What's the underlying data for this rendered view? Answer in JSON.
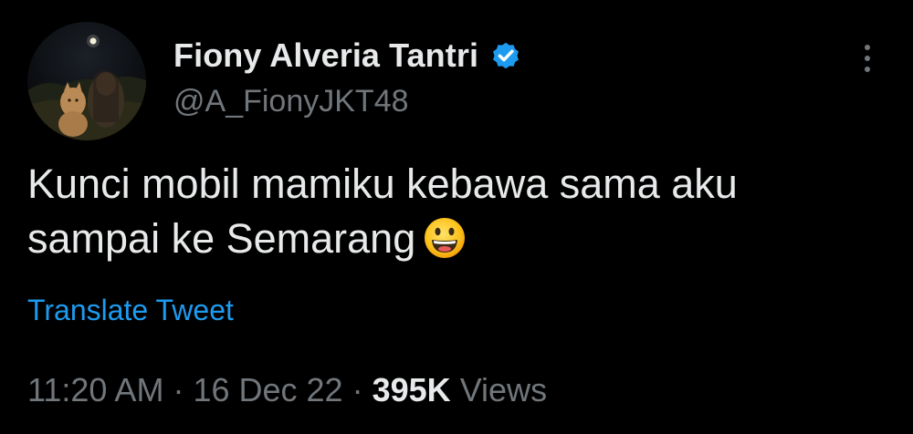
{
  "tweet": {
    "display_name": "Fiony Alveria Tantri",
    "handle": "@A_FionyJKT48",
    "text_line_1": "Kunci mobil mamiku kebawa sama aku",
    "text_line_2": "sampai ke Semarang",
    "emoji": "grinning-face-emoji",
    "translate_label": "Translate Tweet",
    "time": "11:20 AM",
    "separator": "·",
    "date": "16 Dec 22",
    "views_count": "395K",
    "views_label": "Views"
  },
  "icons": {
    "verified": "verified-badge-icon",
    "more": "more-options-icon"
  },
  "colors": {
    "background": "#000000",
    "primary_text": "#e7e9ea",
    "secondary_text": "#71767b",
    "link": "#1d9bf0",
    "verified": "#1d9bf0"
  }
}
